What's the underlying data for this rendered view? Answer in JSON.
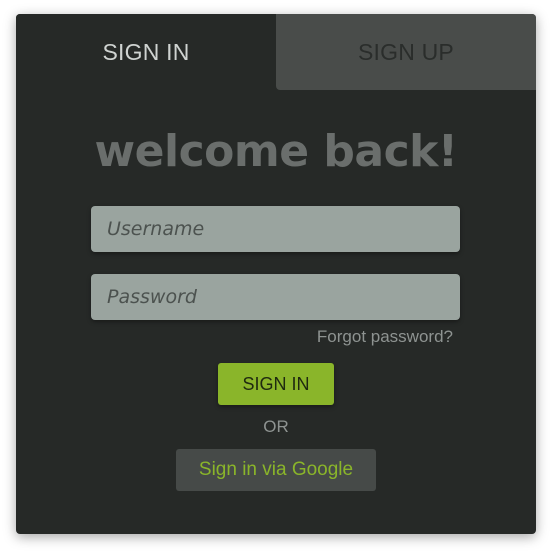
{
  "tabs": {
    "signin_label": "SIGN IN",
    "signup_label": "SIGN UP",
    "active": "signin"
  },
  "form": {
    "heading": "welcome back!",
    "username_placeholder": "Username",
    "username_value": "",
    "password_placeholder": "Password",
    "password_value": "",
    "forgot_label": "Forgot password?",
    "submit_label": "SIGN IN",
    "divider_label": "OR",
    "google_label": "Sign in via Google"
  },
  "colors": {
    "card_background": "#262927",
    "inactive_tab": "#494c4a",
    "input_background": "#9aa49f",
    "accent_green": "#8ab52a",
    "google_button_background": "#464a48"
  }
}
